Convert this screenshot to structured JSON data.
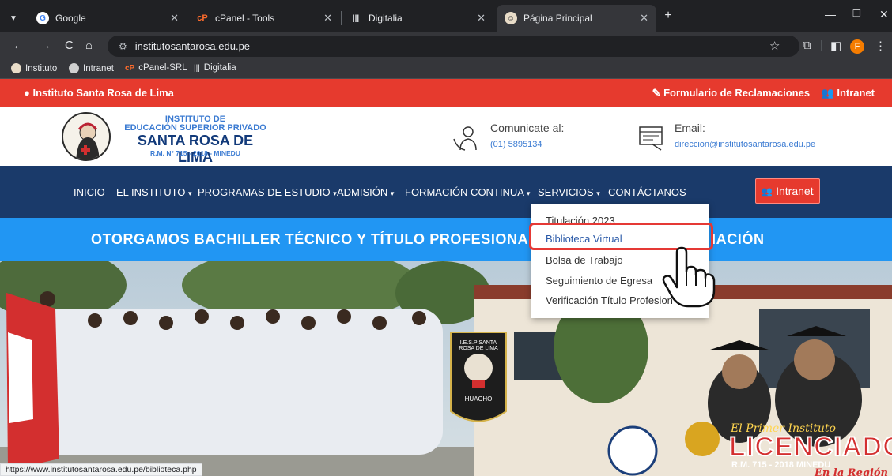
{
  "browser": {
    "tabs": [
      {
        "title": "Google"
      },
      {
        "title": "cPanel - Tools"
      },
      {
        "title": "Digitalia"
      },
      {
        "title": "Página Principal"
      }
    ],
    "url": "institutosantarosa.edu.pe",
    "profile_initial": "F",
    "bookmarks": [
      "Instituto",
      "Intranet",
      "cPanel-SRL",
      "Digitalia"
    ]
  },
  "site": {
    "top_bar": {
      "location": "Instituto Santa Rosa de Lima",
      "claims": "Formulario de Reclamaciones",
      "intranet": "Intranet"
    },
    "header": {
      "line1": "INSTITUTO DE",
      "line2": "EDUCACIÓN SUPERIOR PRIVADO",
      "name": "SANTA ROSA DE LIMA",
      "rm": "R.M. N° 715 - 2018 - MINEDU",
      "contact_title": "Comunicate al:",
      "contact_phone": "(01) 5895134",
      "email_title": "Email:",
      "email": "direccion@institutosantarosa.edu.pe"
    },
    "nav": [
      "INICIO",
      "EL INSTITUTO",
      "PROGRAMAS DE ESTUDIO",
      "ADMISIÓN",
      "FORMACIÓN CONTINUA",
      "SERVICIOS",
      "CONTÁCTANOS"
    ],
    "nav_intranet": "Intranet",
    "banner": "OTORGAMOS BACHILLER TÉCNICO Y TÍTULO PROFESIONAL TE",
    "banner_tail": "IACIÓN",
    "dropdown": [
      "Titulación 2023",
      "Biblioteca Virtual",
      "Bolsa de Trabajo",
      "Seguimiento de Egresa",
      "Verificación Título Profesion"
    ],
    "hero": {
      "flag_text": "I.E.S.P SANTA ROSA DE LIMA",
      "flag_city": "HUACHO",
      "promo1": "El Primer Instituto",
      "promo2": "LICENCIADO",
      "promo3": "R.M. 715 - 2018 MINEDU",
      "promo4": "En la Región"
    }
  },
  "status_url": "https://www.institutosantarosa.edu.pe/biblioteca.php"
}
